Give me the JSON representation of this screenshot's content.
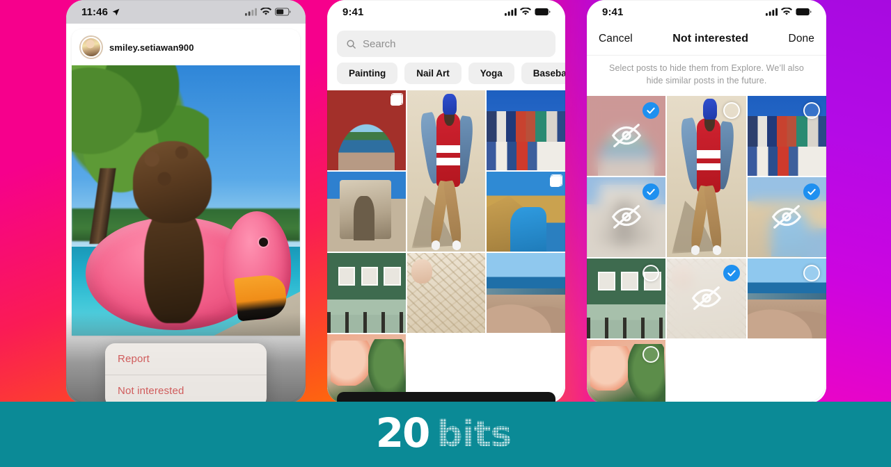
{
  "brand": {
    "logo_primary": "20",
    "logo_secondary": "bits",
    "band_color": "#0b8a96"
  },
  "backdrop": {
    "left_gradient_start": "#f6008c",
    "left_gradient_end": "#ff8a00",
    "right_gradient_start": "#a70ae0",
    "right_gradient_end": "#f8029a"
  },
  "phone1": {
    "status": {
      "time": "11:46",
      "location_icon": "location-arrow-icon",
      "signal_icon": "cellular-signal-icon",
      "wifi_icon": "wifi-icon",
      "battery_icon": "battery-icon"
    },
    "post": {
      "username": "smiley.setiawan900",
      "avatar_name": "user-avatar",
      "media_description": "dog-in-flamingo-pool-float"
    },
    "context_menu": {
      "items": [
        {
          "label": "Report",
          "color": "#d05c5c"
        },
        {
          "label": "Not interested",
          "color": "#d05c5c"
        }
      ]
    }
  },
  "phone2": {
    "status": {
      "time": "9:41",
      "signal_icon": "cellular-signal-icon",
      "wifi_icon": "wifi-icon",
      "battery_icon": "battery-icon"
    },
    "search": {
      "placeholder": "Search",
      "icon": "search-icon",
      "value": ""
    },
    "chips": [
      {
        "label": "Painting"
      },
      {
        "label": "Nail Art"
      },
      {
        "label": "Yoga"
      },
      {
        "label": "Baseball"
      }
    ],
    "grid": [
      {
        "name": "arch-sea-view",
        "style": "img-arch",
        "multi": true
      },
      {
        "name": "dancer-red-shirt",
        "style": "img-dancer",
        "tall": true,
        "multi": false
      },
      {
        "name": "group-of-friends",
        "style": "img-group",
        "multi": false
      },
      {
        "name": "stone-monument",
        "style": "img-monument",
        "multi": false
      },
      {
        "name": "couple-outdoors",
        "style": "img-couple",
        "multi": true
      },
      {
        "name": "green-dining-room",
        "style": "img-dining",
        "multi": false
      },
      {
        "name": "sand-texture",
        "style": "img-sand",
        "multi": false
      },
      {
        "name": "coastal-cliff-view",
        "style": "img-coast",
        "multi": false
      },
      {
        "name": "flowers-closeup",
        "style": "img-flowers",
        "multi": false
      }
    ]
  },
  "phone3": {
    "status": {
      "time": "9:41",
      "signal_icon": "cellular-signal-icon",
      "wifi_icon": "wifi-icon",
      "battery_icon": "battery-icon"
    },
    "header": {
      "cancel_label": "Cancel",
      "title": "Not interested",
      "done_label": "Done"
    },
    "description": "Select posts to hide them from Explore. We’ll also hide similar posts in the future.",
    "selection": {
      "checked_color": "#1e90f0",
      "hidden_icon": "eye-slash-icon",
      "checked_icon": "checkmark-icon",
      "unchecked_icon": "empty-circle-icon"
    },
    "grid": [
      {
        "name": "arch-sea-view",
        "style": "img-arch",
        "selected": true
      },
      {
        "name": "dancer-red-shirt",
        "style": "img-dancer",
        "tall": true,
        "selected": false
      },
      {
        "name": "group-of-friends",
        "style": "img-group",
        "selected": false
      },
      {
        "name": "stone-monument",
        "style": "img-monument",
        "selected": true
      },
      {
        "name": "couple-outdoors",
        "style": "img-couple",
        "selected": true
      },
      {
        "name": "green-dining-room",
        "style": "img-dining",
        "selected": false
      },
      {
        "name": "sand-texture",
        "style": "img-sand",
        "selected": true
      },
      {
        "name": "coastal-cliff-view",
        "style": "img-coast",
        "selected": false
      },
      {
        "name": "flowers-closeup",
        "style": "img-flowers",
        "selected": false
      }
    ]
  }
}
